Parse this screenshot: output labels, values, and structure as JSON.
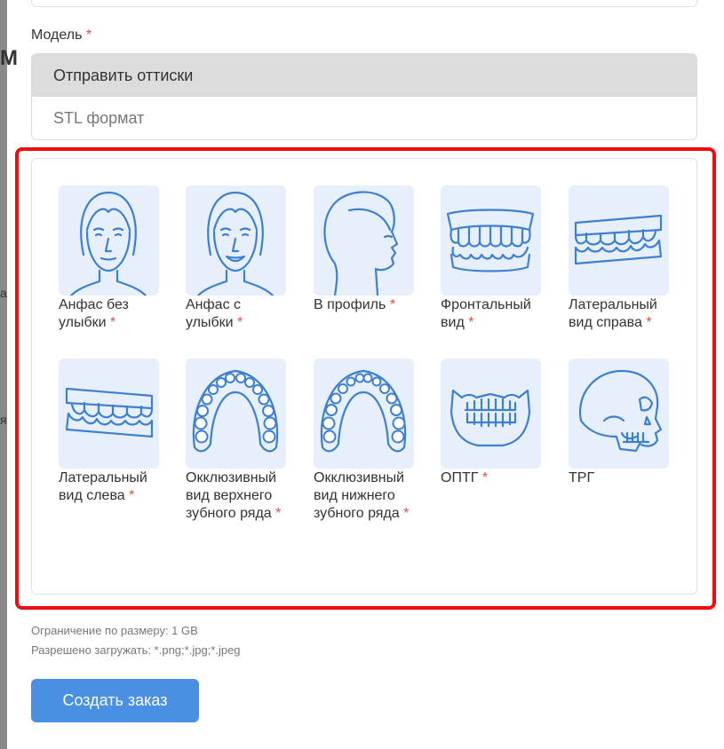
{
  "form": {
    "model_label": "Модель",
    "required_mark": "*",
    "model_options": [
      "Отправить оттиски",
      "STL формат"
    ],
    "selected_index": 0
  },
  "photos": [
    {
      "label": "Анфас без улыбки",
      "required": true,
      "icon": "face-front-neutral-icon"
    },
    {
      "label": "Анфас с улыбки",
      "required": true,
      "icon": "face-front-smile-icon"
    },
    {
      "label": "В профиль",
      "required": true,
      "icon": "face-profile-icon"
    },
    {
      "label": "Фронтальный вид",
      "required": true,
      "icon": "teeth-frontal-icon"
    },
    {
      "label": "Латеральный вид справа",
      "required": true,
      "icon": "teeth-lateral-right-icon"
    },
    {
      "label": "Латеральный вид слева",
      "required": true,
      "icon": "teeth-lateral-left-icon"
    },
    {
      "label": "Окклюзивный вид верхнего зубного ряда",
      "required": true,
      "icon": "occlusal-upper-icon"
    },
    {
      "label": "Окклюзивный вид нижнего зубного ряда",
      "required": true,
      "icon": "occlusal-lower-icon"
    },
    {
      "label": "ОПТГ",
      "required": true,
      "icon": "opg-xray-icon"
    },
    {
      "label": "ТРГ",
      "required": false,
      "icon": "skull-trg-icon"
    }
  ],
  "footer": {
    "size_limit": "Ограничение по размеру: 1 GB",
    "allowed_types": "Разрешено загружать: *.png;*.jpg;*.jpeg",
    "create_button": "Создать заказ"
  },
  "colors": {
    "accent": "#4a90e2",
    "required": "#e34b4b",
    "tile_bg": "#e7effb",
    "icon_stroke": "#3d7fd1",
    "highlight": "#ee0d0d"
  }
}
